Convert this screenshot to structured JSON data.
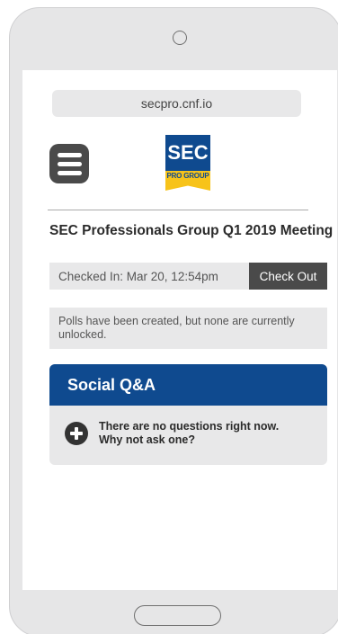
{
  "browser": {
    "url": "secpro.cnf.io"
  },
  "logo": {
    "top_text": "SEC",
    "bottom_text": "PRO GROUP",
    "primary_color": "#0f4a8f",
    "accent_color": "#f7c31a"
  },
  "menu": {
    "icon": "hamburger-menu-icon"
  },
  "event": {
    "title": "SEC Professionals Group Q1 2019 Meeting"
  },
  "checkin": {
    "status": "Checked In: Mar 20, 12:54pm",
    "checkout_label": "Check Out"
  },
  "polls": {
    "message": "Polls have been created, but none are currently unlocked."
  },
  "social_qa": {
    "title": "Social Q&A",
    "empty_line1": "There are no questions right now.",
    "empty_line2": "Why not ask one?",
    "icon": "plus-circle-icon"
  }
}
